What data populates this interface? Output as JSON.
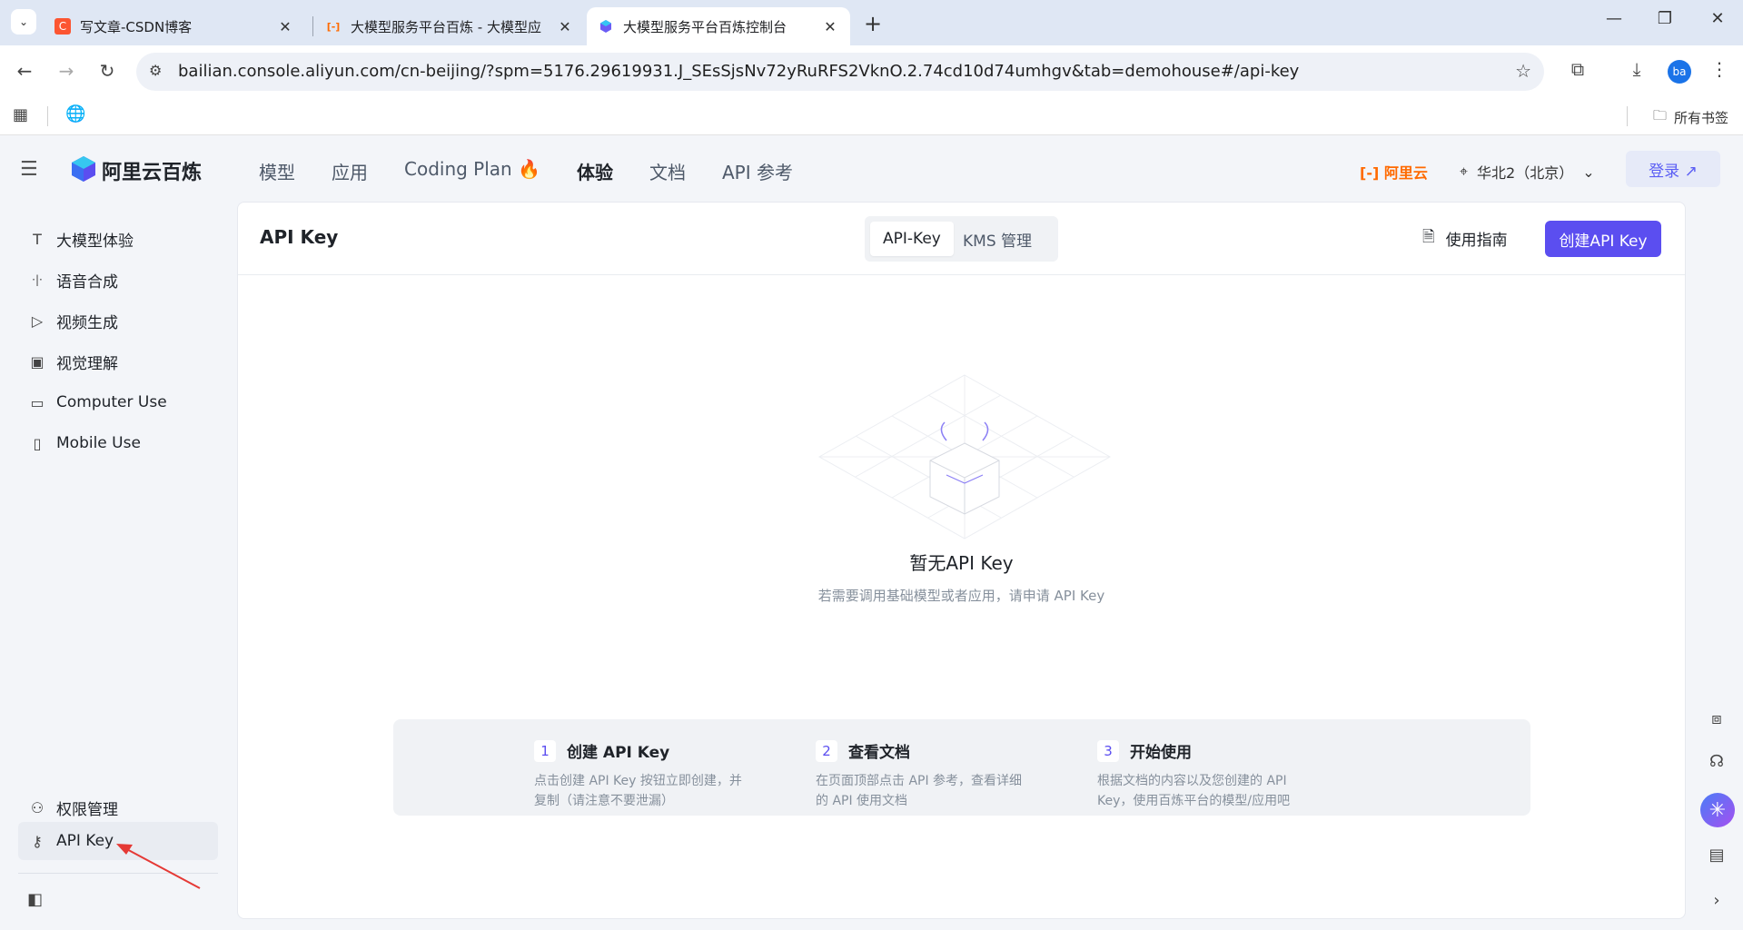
{
  "browser": {
    "tabs": [
      {
        "title": "写文章-CSDN博客",
        "favicon": "C",
        "favicon_color": "#fc5531"
      },
      {
        "title": "大模型服务平台百炼 - 大模型应",
        "favicon": "[-]",
        "favicon_color": "#ff6a00"
      },
      {
        "title": "大模型服务平台百炼控制台",
        "favicon": "",
        "favicon_color": "#6b5cf5"
      }
    ],
    "new_tab": "+",
    "url": "bailian.console.aliyun.com/cn-beijing/?spm=5176.29619931.J_SEsSjsNv72yRuRFS2VknO.2.74cd10d74umhgv&tab=demohouse#/api-key",
    "profile_initials": "ba",
    "bookmarks_all": "所有书签"
  },
  "header": {
    "logo_text": "阿里云百炼",
    "nav": [
      "模型",
      "应用",
      "Coding Plan 🔥",
      "体验",
      "文档",
      "API 参考"
    ],
    "active_nav": "体验",
    "aliyun_label": "[-] 阿里云",
    "region": "华北2（北京）",
    "login": "登录 ↗"
  },
  "sidebar": {
    "items": [
      {
        "label": "大模型体验",
        "icon": "T"
      },
      {
        "label": "语音合成",
        "icon": "·|·"
      },
      {
        "label": "视频生成",
        "icon": "▷"
      },
      {
        "label": "视觉理解",
        "icon": "▣"
      },
      {
        "label": "Computer Use",
        "icon": "▭"
      },
      {
        "label": "Mobile Use",
        "icon": "▯"
      }
    ],
    "bottom_items": [
      {
        "label": "权限管理",
        "icon": "⚇"
      },
      {
        "label": "API Key",
        "icon": "⚷"
      }
    ]
  },
  "main": {
    "title": "API Key",
    "tabs": [
      "API-Key",
      "KMS 管理"
    ],
    "guide": "使用指南",
    "create": "创建API Key",
    "empty_title": "暂无API Key",
    "empty_sub": "若需要调用基础模型或者应用，请申请 API Key",
    "steps": [
      {
        "num": "1",
        "title": "创建 API Key",
        "desc": "点击创建 API Key 按钮立即创建，并复制（请注意不要泄漏）"
      },
      {
        "num": "2",
        "title": "查看文档",
        "desc": "在页面顶部点击 API 参考，查看详细的 API 使用文档"
      },
      {
        "num": "3",
        "title": "开始使用",
        "desc": "根据文档的内容以及您创建的 API Key，使用百炼平台的模型/应用吧"
      }
    ]
  },
  "colors": {
    "accent": "#5b4ef0",
    "annotation_arrow": "#e53935"
  }
}
